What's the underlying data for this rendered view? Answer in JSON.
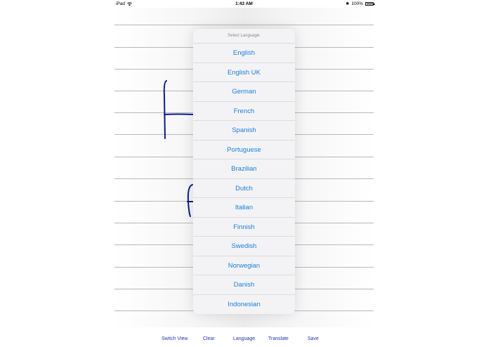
{
  "status_bar": {
    "device": "iPad",
    "time": "1:43 AM",
    "battery": "100%",
    "battery_level": 1.0
  },
  "language_popover": {
    "title": "Select Language:",
    "languages": [
      "English",
      "English UK",
      "German",
      "French",
      "Spanish",
      "Portuguese",
      "Brazilian",
      "Dutch",
      "Italian",
      "Finnish",
      "Swedish",
      "Norwegian",
      "Danish",
      "Indonesian"
    ]
  },
  "toolbar": {
    "switch_view": "Switch View",
    "clear": "Clear",
    "language": "Language",
    "translate": "Translate",
    "save": "Save"
  },
  "colors": {
    "accent": "#1a7fe0",
    "toolbar_text": "#1f36b8",
    "ink": "#0a1a9c",
    "ruled_line": "#b8b8b8"
  }
}
